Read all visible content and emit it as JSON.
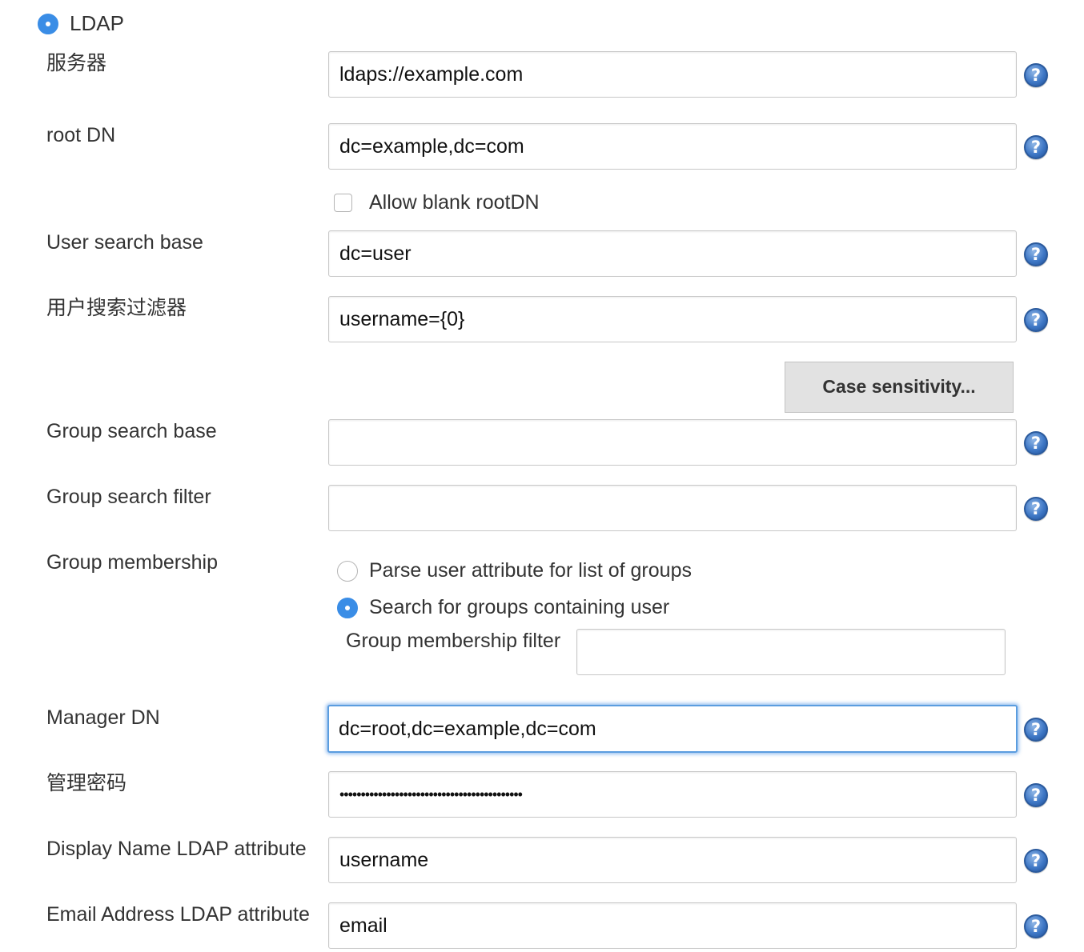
{
  "ldap_option": {
    "label": "LDAP",
    "selected": true
  },
  "server": {
    "label": "服务器",
    "value": "ldaps://example.com"
  },
  "root_dn": {
    "label": "root DN",
    "value": "dc=example,dc=com"
  },
  "allow_blank_rootdn": {
    "label": "Allow blank rootDN",
    "checked": false
  },
  "user_search_base": {
    "label": "User search base",
    "value": "dc=user"
  },
  "user_search_filter": {
    "label": "用户搜索过滤器",
    "value": "username={0}"
  },
  "case_sensitivity_button": {
    "label": "Case sensitivity..."
  },
  "group_search_base": {
    "label": "Group search base",
    "value": ""
  },
  "group_search_filter": {
    "label": "Group search filter",
    "value": ""
  },
  "group_membership": {
    "label": "Group membership",
    "options": [
      {
        "label": "Parse user attribute for list of groups",
        "selected": false
      },
      {
        "label": "Search for groups containing user",
        "selected": true
      }
    ],
    "filter_label": "Group membership filter",
    "filter_value": ""
  },
  "manager_dn": {
    "label": "Manager DN",
    "value": "dc=root,dc=example,dc=com"
  },
  "manager_password": {
    "label": "管理密码",
    "value": "•••••••••••••••••••••••••••••••••••••••••••"
  },
  "display_name_attr": {
    "label": "Display Name LDAP attribute",
    "value": "username"
  },
  "email_attr": {
    "label": "Email Address LDAP attribute",
    "value": "email"
  },
  "help_icon": {
    "glyph": "?",
    "color": "#3f78c6"
  },
  "accent_color": "#3a8de6"
}
